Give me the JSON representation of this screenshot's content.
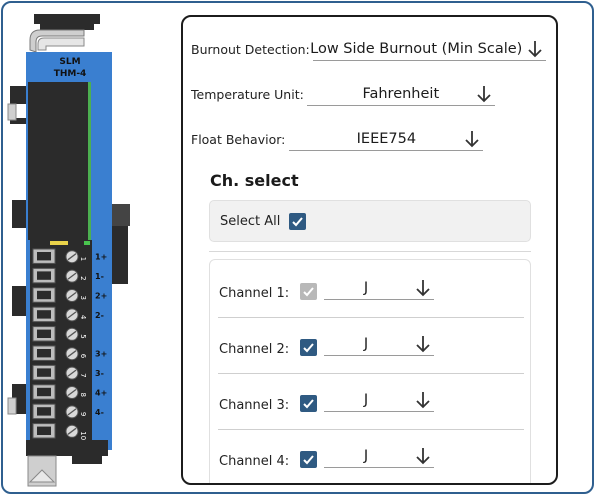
{
  "device": {
    "brand": "SLM",
    "model": "THM-4",
    "terminal_numbers": [
      "1",
      "2",
      "3",
      "4",
      "5",
      "6",
      "7",
      "8",
      "9",
      "10"
    ],
    "terminal_labels": [
      "1+",
      "1-",
      "2+",
      "2-",
      "",
      "3+",
      "3-",
      "4+",
      "4-",
      ""
    ],
    "colors": {
      "body": "#3a7fd0",
      "housing": "#2b2b2b",
      "terminal": "#b9b9b9"
    }
  },
  "config": {
    "burnout": {
      "label": "Burnout Detection:",
      "value": "Low Side Burnout (Min Scale)"
    },
    "temp_unit": {
      "label": "Temperature Unit:",
      "value": "Fahrenheit"
    },
    "float_behavior": {
      "label": "Float Behavior:",
      "value": "IEEE754"
    }
  },
  "channel_select": {
    "title": "Ch. select",
    "select_all_label": "Select All",
    "select_all_checked": true,
    "channels": [
      {
        "label": "Channel 1:",
        "checked": true,
        "disabled": true,
        "type": "J"
      },
      {
        "label": "Channel 2:",
        "checked": true,
        "disabled": false,
        "type": "J"
      },
      {
        "label": "Channel 3:",
        "checked": true,
        "disabled": false,
        "type": "J"
      },
      {
        "label": "Channel 4:",
        "checked": true,
        "disabled": false,
        "type": "J"
      }
    ]
  },
  "colors": {
    "accent": "#2f5a82",
    "frame": "#2f5f8f"
  }
}
